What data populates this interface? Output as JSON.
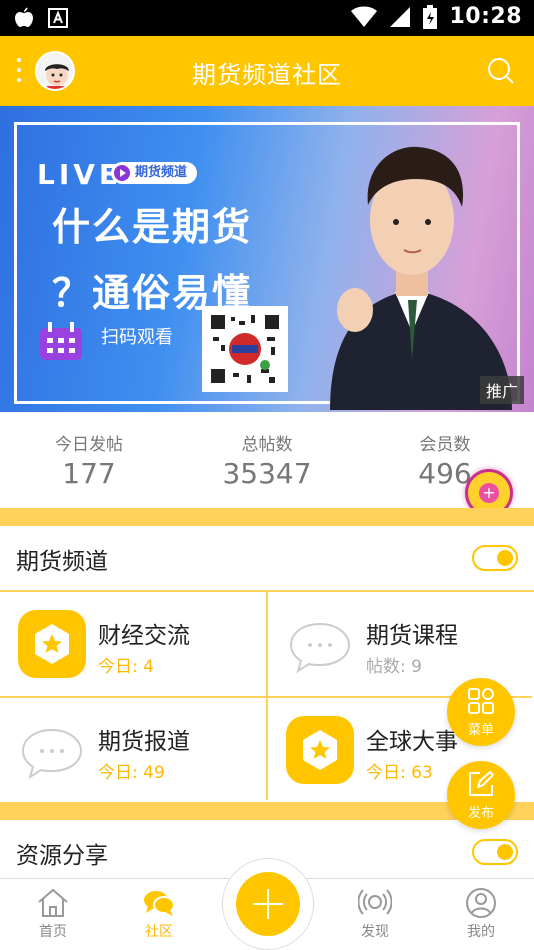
{
  "status_bar": {
    "time": "10:28"
  },
  "header": {
    "title": "期货频道社区"
  },
  "banner": {
    "live": "LIVE",
    "channel": "期货频道",
    "line1": "什么是期货",
    "line2": "？通俗易懂",
    "scan": "扫码观看",
    "ad_tag": "推广"
  },
  "stats": [
    {
      "label": "今日发帖",
      "value": "177"
    },
    {
      "label": "总帖数",
      "value": "35347"
    },
    {
      "label": "会员数",
      "value": "496"
    }
  ],
  "sections": [
    {
      "title": "期货频道"
    },
    {
      "title": "资源分享"
    }
  ],
  "forums": [
    {
      "name": "财经交流",
      "stat": "今日: 4"
    },
    {
      "name": "期货课程",
      "stat": "帖数: 9"
    },
    {
      "name": "期货报道",
      "stat": "今日: 49"
    },
    {
      "name": "全球大事",
      "stat": "今日: 63"
    }
  ],
  "fabs": {
    "menu": "菜单",
    "publish": "发布"
  },
  "nav": [
    {
      "label": "首页"
    },
    {
      "label": "社区"
    },
    {
      "label": "发现"
    },
    {
      "label": "我的"
    }
  ],
  "colors": {
    "accent": "#ffc600",
    "separator": "#ffd25a",
    "active_text": "#ffb800"
  }
}
